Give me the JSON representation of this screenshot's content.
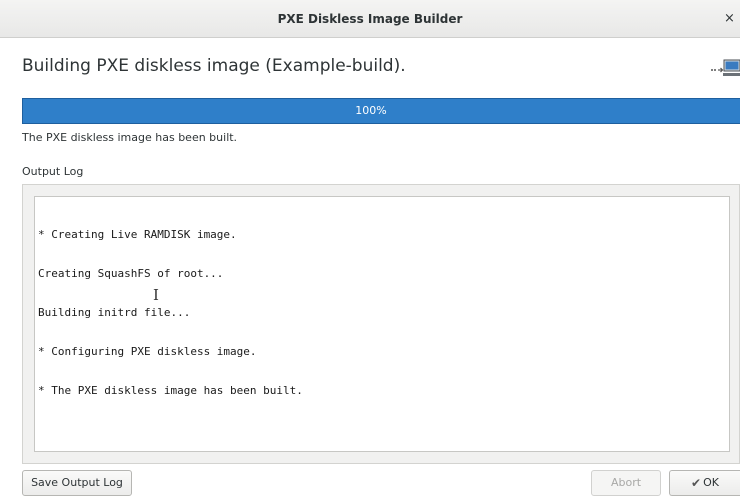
{
  "window": {
    "title": "PXE Diskless Image Builder",
    "close_glyph": "×"
  },
  "header": {
    "heading": "Building PXE diskless image (Example-build).",
    "icon": "network-computer-icon"
  },
  "progress": {
    "value": 100,
    "label": "100%"
  },
  "status_text": "The PXE diskless image has been built.",
  "log": {
    "label": "Output Log",
    "lines": [
      "* Creating Live RAMDISK image.",
      "Creating SquashFS of root...",
      "Building initrd file...",
      "* Configuring PXE diskless image.",
      "* The PXE diskless image has been built."
    ]
  },
  "buttons": {
    "save_label": "Save Output Log",
    "abort_label": "Abort",
    "ok_label": "OK",
    "ok_icon": "checkmark-icon"
  },
  "colors": {
    "progress_fill": "#2f7fc9",
    "progress_text": "#ffffff"
  }
}
